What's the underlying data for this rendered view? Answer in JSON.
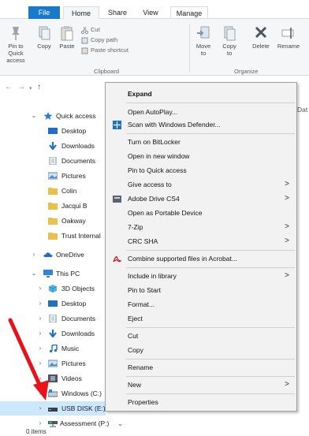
{
  "ribbon_tabs": {
    "file": "File",
    "home": "Home",
    "share": "Share",
    "view": "View",
    "manage": "Manage"
  },
  "ribbon": {
    "pin": "Pin to Quick access",
    "copy": "Copy",
    "paste": "Paste",
    "cut": "Cut",
    "copy_path": "Copy path",
    "paste_shortcut": "Paste shortcut",
    "clipboard_group": "Clipboard",
    "move_to": "Move to",
    "copy_to": "Copy to",
    "delete": "Delete",
    "rename": "Rename",
    "organize_group": "Organize"
  },
  "date_column": "Dat",
  "nav": {
    "quick_access": "Quick access",
    "desktop": "Desktop",
    "downloads": "Downloads",
    "documents": "Documents",
    "pictures": "Pictures",
    "colin": "Colin",
    "jacqui": "Jacqui B",
    "oakway": "Oakway",
    "trust": "Trust Internal",
    "onedrive": "OneDrive",
    "this_pc": "This PC",
    "objects3d": "3D Objects",
    "pc_desktop": "Desktop",
    "pc_documents": "Documents",
    "pc_downloads": "Downloads",
    "music": "Music",
    "pc_pictures": "Pictures",
    "videos": "Videos",
    "windows": "Windows (C:)",
    "usb": "USB DISK (E:)",
    "assessment": "Assessment (P:)"
  },
  "status": "0 items",
  "menu": {
    "expand": "Expand",
    "autoplay": "Open AutoPlay...",
    "defender": "Scan with Windows Defender...",
    "bitlocker": "Turn on BitLocker",
    "new_window": "Open in new window",
    "pin_quick": "Pin to Quick access",
    "give_access": "Give access to",
    "adobe_drive": "Adobe Drive CS4",
    "portable": "Open as Portable Device",
    "zip": "7-Zip",
    "crc": "CRC SHA",
    "combine": "Combine supported files in Acrobat...",
    "library": "Include in library",
    "pin_start": "Pin to Start",
    "format": "Format...",
    "eject": "Eject",
    "cut": "Cut",
    "copy": "Copy",
    "rename": "Rename",
    "new": "New",
    "properties": "Properties"
  },
  "colors": {
    "file_tab": "#1979ca",
    "selection": "#cce8ff",
    "arrow": "#e8121a",
    "folder": "#e8c04a"
  }
}
